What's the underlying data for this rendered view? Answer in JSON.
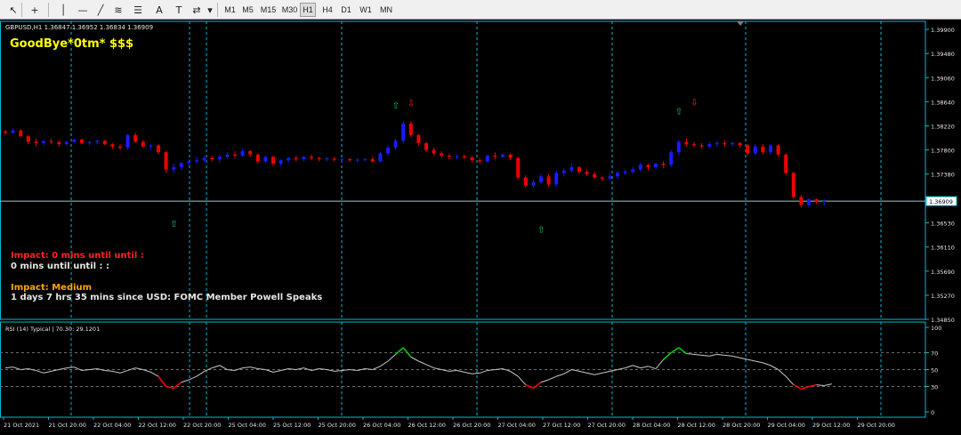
{
  "toolbar": {
    "tools": [
      {
        "name": "cursor-icon",
        "glyph": "↖"
      },
      {
        "name": "crosshair-icon",
        "glyph": "+"
      },
      {
        "name": "vertical-line-icon",
        "glyph": "│"
      },
      {
        "name": "horizontal-line-icon",
        "glyph": "—"
      },
      {
        "name": "trend-line-icon",
        "glyph": "╱"
      },
      {
        "name": "fibonacci-channel-icon",
        "glyph": "≋"
      },
      {
        "name": "fibonacci-retracement-icon",
        "glyph": "☰"
      },
      {
        "name": "text-icon",
        "glyph": "A"
      },
      {
        "name": "text-label-icon",
        "glyph": "T"
      },
      {
        "name": "arrows-icon",
        "glyph": "⇄"
      },
      {
        "name": "dropdown-icon",
        "glyph": "▾"
      }
    ],
    "timeframes": [
      "M1",
      "M5",
      "M15",
      "M30",
      "H1",
      "H4",
      "D1",
      "W1",
      "MN"
    ],
    "active_timeframe": "H1"
  },
  "chart": {
    "symbol_line": "GBPUSD,H1  1.36847 1.36952 1.36834 1.36909",
    "headline": "GoodBye*0tm* $$$",
    "impact_red_label": "Impact: 0 mins until until :",
    "impact_white_line": "0 mins until until : :",
    "impact_medium_label": "Impact: Medium",
    "event_line": "1 days 7 hrs 35 mins since USD: FOMC Member Powell Speaks",
    "current_price": "1.36909",
    "colors": {
      "bull": "#1a1aff",
      "bear": "#ee0000",
      "neutral": "#707070",
      "grid": "#00bcd4",
      "text": "#e6e6e6",
      "headline": "#ffff00",
      "impact_red": "#ff2020",
      "impact_medium": "#ffa500",
      "rsi_line": "#c8c8c8",
      "rsi_overbought": "#00cc00",
      "rsi_oversold": "#ff0000",
      "signal_up": "#22c55e",
      "signal_down": "#ff2222"
    }
  },
  "chart_data": {
    "type": "candlestick",
    "price_axis_ticks": [
      "1.39900",
      "1.39480",
      "1.39060",
      "1.38640",
      "1.38220",
      "1.37800",
      "1.37380",
      "1.36909",
      "1.36530",
      "1.36110",
      "1.35690",
      "1.35270",
      "1.34850"
    ],
    "price_range": [
      1.3485,
      1.4004
    ],
    "candles": [
      [
        1.3812,
        1.3815,
        1.3806,
        1.381
      ],
      [
        1.381,
        1.3818,
        1.3808,
        1.3814
      ],
      [
        1.3814,
        1.3816,
        1.3802,
        1.3804
      ],
      [
        1.3804,
        1.3806,
        1.379,
        1.3794
      ],
      [
        1.3794,
        1.38,
        1.3786,
        1.3792
      ],
      [
        1.3792,
        1.3798,
        1.3788,
        1.3795
      ],
      [
        1.3795,
        1.38,
        1.379,
        1.3794
      ],
      [
        1.3794,
        1.3796,
        1.3786,
        1.379
      ],
      [
        1.379,
        1.3796,
        1.3788,
        1.3794
      ],
      [
        1.3794,
        1.38,
        1.3792,
        1.3798
      ],
      [
        1.3798,
        1.38,
        1.379,
        1.3792
      ],
      [
        1.3792,
        1.3796,
        1.3788,
        1.3794
      ],
      [
        1.3794,
        1.3798,
        1.379,
        1.3796
      ],
      [
        1.3796,
        1.3798,
        1.3788,
        1.379
      ],
      [
        1.379,
        1.3792,
        1.3782,
        1.3786
      ],
      [
        1.3786,
        1.379,
        1.378,
        1.3784
      ],
      [
        1.3784,
        1.3808,
        1.378,
        1.3806
      ],
      [
        1.3806,
        1.381,
        1.3792,
        1.3794
      ],
      [
        1.3794,
        1.3798,
        1.3784,
        1.3786
      ],
      [
        1.3786,
        1.379,
        1.378,
        1.3788
      ],
      [
        1.3788,
        1.379,
        1.3772,
        1.3776
      ],
      [
        1.3776,
        1.3778,
        1.374,
        1.3746
      ],
      [
        1.3746,
        1.3756,
        1.374,
        1.375
      ],
      [
        1.375,
        1.376,
        1.3745,
        1.3757
      ],
      [
        1.3757,
        1.3764,
        1.3752,
        1.376
      ],
      [
        1.376,
        1.3768,
        1.3756,
        1.3762
      ],
      [
        1.3762,
        1.377,
        1.3758,
        1.3766
      ],
      [
        1.3766,
        1.377,
        1.376,
        1.3764
      ],
      [
        1.3764,
        1.3772,
        1.3758,
        1.3768
      ],
      [
        1.3768,
        1.3776,
        1.3764,
        1.3772
      ],
      [
        1.3772,
        1.3778,
        1.3766,
        1.377
      ],
      [
        1.377,
        1.3782,
        1.3768,
        1.3778
      ],
      [
        1.3778,
        1.378,
        1.3768,
        1.3772
      ],
      [
        1.3772,
        1.3774,
        1.3756,
        1.376
      ],
      [
        1.376,
        1.377,
        1.3756,
        1.3768
      ],
      [
        1.3768,
        1.377,
        1.3752,
        1.3756
      ],
      [
        1.3756,
        1.3764,
        1.3752,
        1.3762
      ],
      [
        1.3762,
        1.3768,
        1.3758,
        1.3766
      ],
      [
        1.3766,
        1.377,
        1.376,
        1.3764
      ],
      [
        1.3764,
        1.377,
        1.376,
        1.3768
      ],
      [
        1.3768,
        1.3772,
        1.3762,
        1.3766
      ],
      [
        1.3766,
        1.3768,
        1.376,
        1.3764
      ],
      [
        1.3764,
        1.3768,
        1.376,
        1.3765
      ],
      [
        1.3765,
        1.3768,
        1.376,
        1.3763
      ],
      [
        1.3763,
        1.3766,
        1.3758,
        1.3764
      ],
      [
        1.3764,
        1.3766,
        1.376,
        1.3762
      ],
      [
        1.3762,
        1.3766,
        1.3758,
        1.3763
      ],
      [
        1.3763,
        1.3766,
        1.376,
        1.3764
      ],
      [
        1.3764,
        1.3768,
        1.3758,
        1.376
      ],
      [
        1.376,
        1.3776,
        1.3758,
        1.3774
      ],
      [
        1.3774,
        1.3788,
        1.377,
        1.3784
      ],
      [
        1.3784,
        1.38,
        1.378,
        1.3796
      ],
      [
        1.3796,
        1.383,
        1.3792,
        1.3826
      ],
      [
        1.3826,
        1.383,
        1.3802,
        1.3806
      ],
      [
        1.3806,
        1.3808,
        1.3788,
        1.3792
      ],
      [
        1.3792,
        1.3794,
        1.3776,
        1.378
      ],
      [
        1.378,
        1.3784,
        1.377,
        1.3774
      ],
      [
        1.3774,
        1.3778,
        1.3766,
        1.377
      ],
      [
        1.377,
        1.3774,
        1.3764,
        1.3768
      ],
      [
        1.3768,
        1.3772,
        1.3764,
        1.3769
      ],
      [
        1.3769,
        1.3772,
        1.3764,
        1.3767
      ],
      [
        1.3767,
        1.377,
        1.3758,
        1.3762
      ],
      [
        1.3762,
        1.3766,
        1.3756,
        1.376
      ],
      [
        1.376,
        1.3772,
        1.3758,
        1.377
      ],
      [
        1.377,
        1.3776,
        1.3764,
        1.3768
      ],
      [
        1.3768,
        1.3774,
        1.3766,
        1.3772
      ],
      [
        1.3772,
        1.3774,
        1.3762,
        1.3766
      ],
      [
        1.3766,
        1.3768,
        1.3728,
        1.3732
      ],
      [
        1.3732,
        1.3736,
        1.3714,
        1.3718
      ],
      [
        1.3718,
        1.3728,
        1.3714,
        1.3724
      ],
      [
        1.3724,
        1.3738,
        1.372,
        1.3734
      ],
      [
        1.3734,
        1.3738,
        1.3716,
        1.372
      ],
      [
        1.372,
        1.3744,
        1.3716,
        1.374
      ],
      [
        1.374,
        1.3748,
        1.3734,
        1.3744
      ],
      [
        1.3744,
        1.3756,
        1.374,
        1.375
      ],
      [
        1.375,
        1.3752,
        1.3738,
        1.3742
      ],
      [
        1.3742,
        1.3746,
        1.3734,
        1.3738
      ],
      [
        1.3738,
        1.3742,
        1.373,
        1.3732
      ],
      [
        1.3732,
        1.3734,
        1.3726,
        1.373
      ],
      [
        1.373,
        1.3738,
        1.3726,
        1.3734
      ],
      [
        1.3734,
        1.3744,
        1.373,
        1.374
      ],
      [
        1.374,
        1.3746,
        1.3736,
        1.3742
      ],
      [
        1.3742,
        1.375,
        1.3738,
        1.3746
      ],
      [
        1.3746,
        1.3758,
        1.3742,
        1.3754
      ],
      [
        1.3754,
        1.3756,
        1.3744,
        1.375
      ],
      [
        1.375,
        1.3758,
        1.3746,
        1.3756
      ],
      [
        1.3756,
        1.376,
        1.3748,
        1.3754
      ],
      [
        1.3754,
        1.378,
        1.375,
        1.3776
      ],
      [
        1.3776,
        1.3798,
        1.3772,
        1.3794
      ],
      [
        1.3794,
        1.38,
        1.3786,
        1.379
      ],
      [
        1.379,
        1.3794,
        1.3784,
        1.3788
      ],
      [
        1.3788,
        1.3792,
        1.3782,
        1.3786
      ],
      [
        1.3786,
        1.3794,
        1.3782,
        1.379
      ],
      [
        1.379,
        1.3796,
        1.3786,
        1.3792
      ],
      [
        1.3792,
        1.3796,
        1.3786,
        1.379
      ],
      [
        1.379,
        1.3794,
        1.3786,
        1.3792
      ],
      [
        1.3792,
        1.3794,
        1.3784,
        1.3788
      ],
      [
        1.3788,
        1.379,
        1.377,
        1.3774
      ],
      [
        1.3774,
        1.379,
        1.377,
        1.3786
      ],
      [
        1.3786,
        1.379,
        1.3772,
        1.3776
      ],
      [
        1.3776,
        1.379,
        1.3772,
        1.3788
      ],
      [
        1.3788,
        1.379,
        1.3768,
        1.3772
      ],
      [
        1.3772,
        1.3774,
        1.3736,
        1.374
      ],
      [
        1.374,
        1.3742,
        1.3694,
        1.3698
      ],
      [
        1.3698,
        1.3702,
        1.368,
        1.3684
      ],
      [
        1.3684,
        1.3696,
        1.368,
        1.3694
      ],
      [
        1.3694,
        1.3696,
        1.3686,
        1.369
      ],
      [
        1.369,
        1.3695,
        1.3683,
        1.3691
      ]
    ],
    "x_axis_labels": [
      "21 Oct 2021",
      "21 Oct 20:00",
      "22 Oct 04:00",
      "22 Oct 12:00",
      "22 Oct 20:00",
      "25 Oct 04:00",
      "25 Oct 12:00",
      "25 Oct 20:00",
      "26 Oct 04:00",
      "26 Oct 12:00",
      "26 Oct 20:00",
      "27 Oct 04:00",
      "27 Oct 12:00",
      "27 Oct 20:00",
      "28 Oct 04:00",
      "28 Oct 12:00",
      "28 Oct 20:00",
      "29 Oct 04:00",
      "29 Oct 12:00",
      "29 Oct 20:00"
    ],
    "buy_arrow_markers": [
      {
        "label": "⇧",
        "price": 1.3652,
        "candle": 22
      },
      {
        "label": "⇧",
        "price": 1.3858,
        "candle": 51
      },
      {
        "label": "⇧",
        "price": 1.3642,
        "candle": 70
      },
      {
        "label": "⇧",
        "price": 1.3848,
        "candle": 88
      }
    ],
    "sell_arrow_markers": [
      {
        "label": "⇩",
        "price": 1.3862,
        "candle": 53
      },
      {
        "label": "⇩",
        "price": 1.3864,
        "candle": 90
      }
    ],
    "rsi": {
      "title": "RSI (14) Typical | 70.30: 29.1201",
      "axis_ticks": [
        "100",
        "70",
        "50",
        "30",
        "0"
      ],
      "levels": [
        70,
        50,
        30
      ],
      "values": [
        52,
        53,
        50,
        51,
        49,
        46,
        48,
        50,
        52,
        53,
        49,
        50,
        51,
        49,
        48,
        46,
        49,
        52,
        50,
        47,
        42,
        30,
        28,
        35,
        38,
        42,
        48,
        52,
        55,
        50,
        49,
        52,
        53,
        51,
        50,
        47,
        49,
        51,
        50,
        52,
        49,
        51,
        50,
        48,
        49,
        50,
        49,
        51,
        50,
        54,
        60,
        68,
        76,
        65,
        60,
        56,
        52,
        50,
        48,
        49,
        47,
        45,
        46,
        49,
        50,
        51,
        48,
        42,
        32,
        28,
        35,
        38,
        42,
        45,
        50,
        48,
        46,
        44,
        46,
        48,
        50,
        52,
        55,
        52,
        54,
        51,
        62,
        70,
        76,
        69,
        68,
        67,
        66,
        68,
        67,
        66,
        64,
        62,
        60,
        58,
        55,
        50,
        42,
        32,
        27,
        30,
        32,
        31,
        33
      ]
    }
  }
}
